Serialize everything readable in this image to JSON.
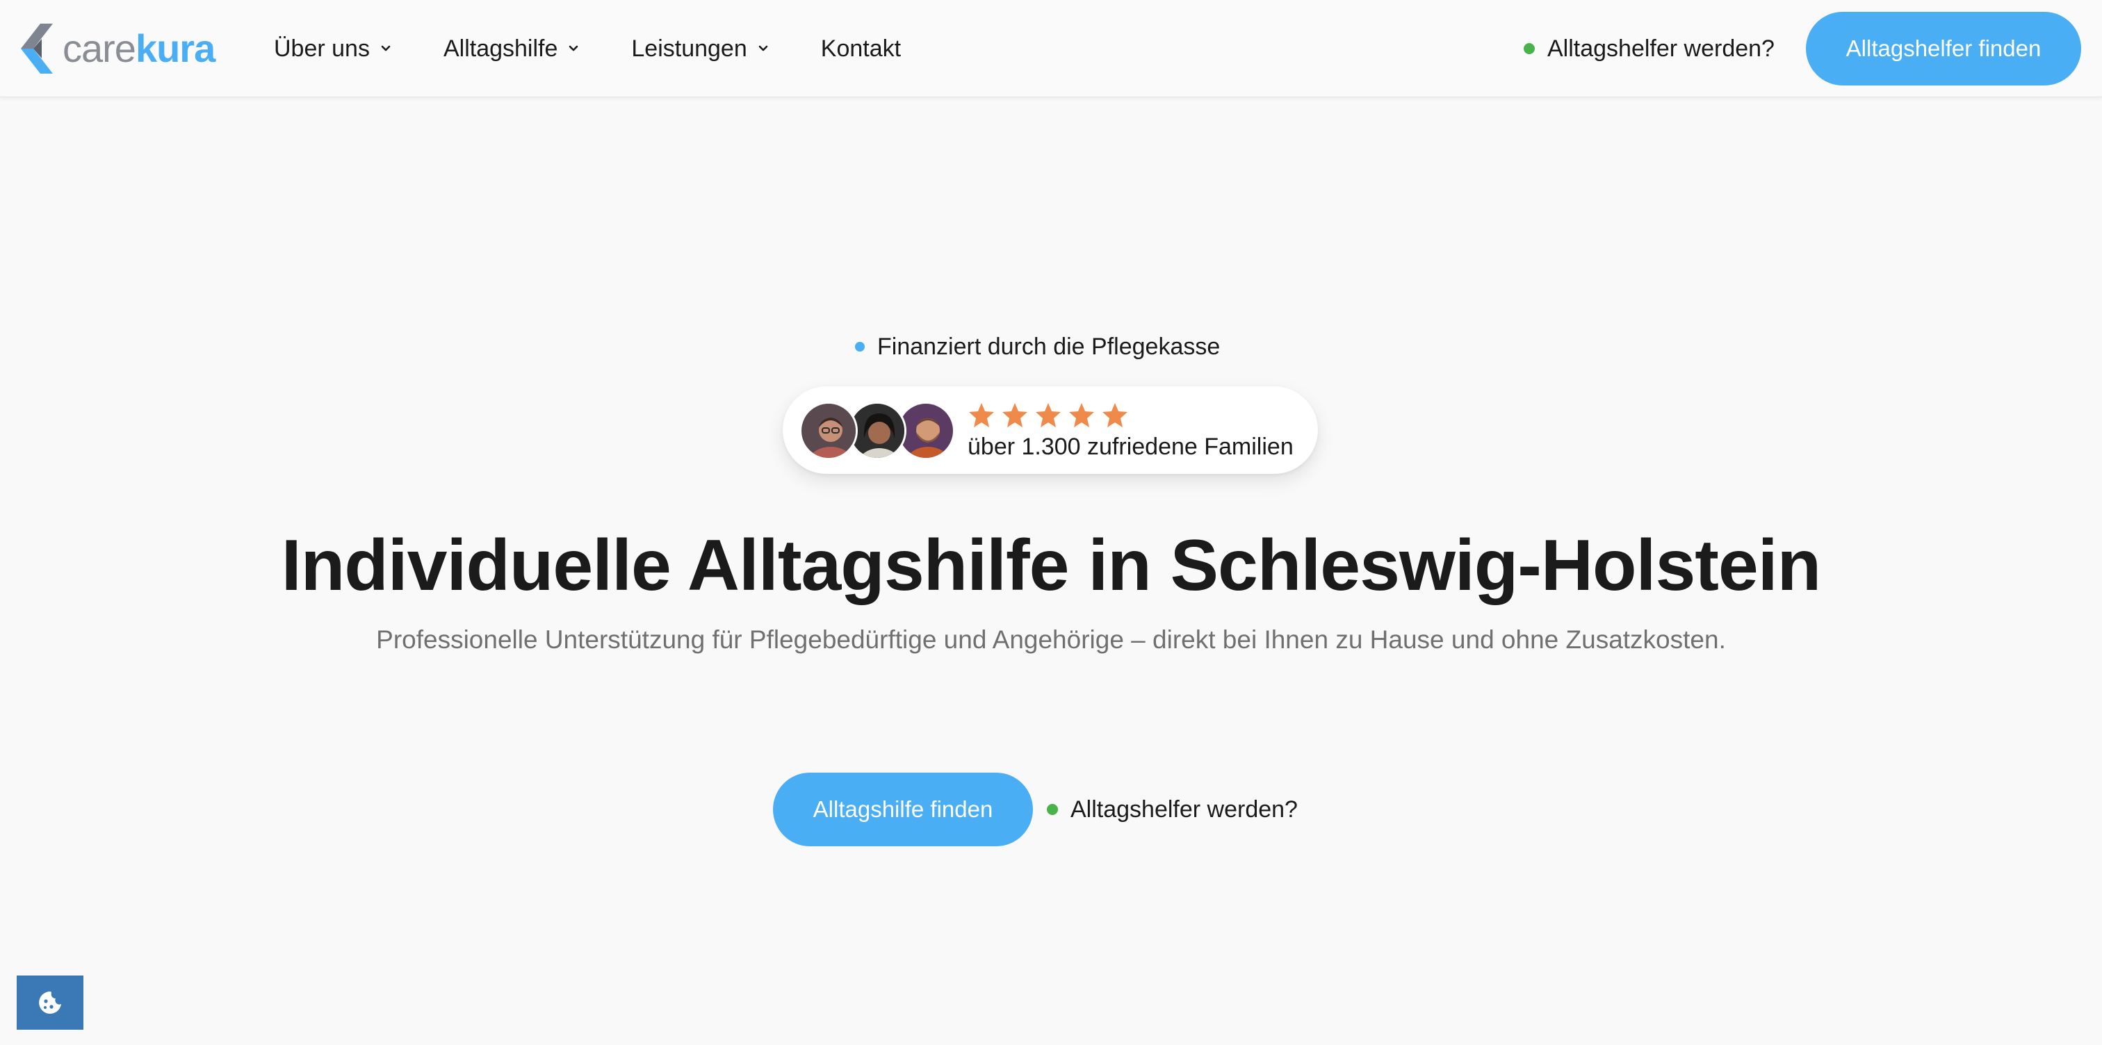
{
  "brand": {
    "name_part1": "care",
    "name_part2": "kura",
    "logo_icon": "carekura-logo-icon",
    "accent_color": "#4aaef5",
    "logo_dark": "#7e8590"
  },
  "nav": {
    "items": [
      {
        "label": "Über uns",
        "has_dropdown": true
      },
      {
        "label": "Alltagshilfe",
        "has_dropdown": true
      },
      {
        "label": "Leistungen",
        "has_dropdown": true
      },
      {
        "label": "Kontakt",
        "has_dropdown": false
      }
    ]
  },
  "header": {
    "helper_link": "Alltagshelfer werden?",
    "cta_label": "Alltagshelfer finden",
    "status_dot_color": "#47b34a"
  },
  "hero": {
    "badge": "Finanziert durch die Pflegekasse",
    "badge_dot_color": "#4aaef5",
    "rating": {
      "stars": 5,
      "star_color": "#f08a4b",
      "text": "über 1.300 zufriedene Familien",
      "avatars": [
        "avatar-man-glasses",
        "avatar-woman",
        "avatar-man-beard"
      ]
    },
    "title": "Individuelle Alltagshilfe in Schleswig-Holstein",
    "subtitle": "Professionelle Unterstützung für Pflegebedürftige und Angehörige – direkt bei Ihnen zu Hause und ohne Zusatzkosten.",
    "cta_label": "Alltagshilfe finden",
    "helper_link": "Alltagshelfer werden?"
  },
  "cookie": {
    "icon": "cookie-icon",
    "color": "#3a79b6"
  }
}
